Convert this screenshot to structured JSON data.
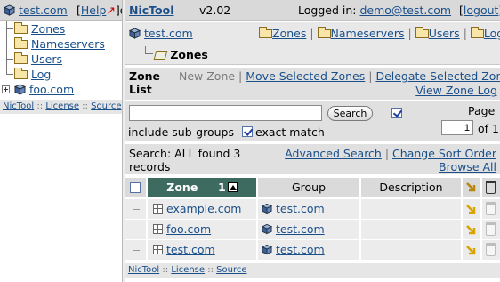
{
  "left": {
    "group": "test.com",
    "help": "Help",
    "help_tail": "]o",
    "tree": [
      "Zones",
      "Nameservers",
      "Users",
      "Log"
    ],
    "subgroup": "foo.com",
    "footer": [
      "NicTool",
      "License",
      "Source"
    ]
  },
  "header": {
    "app": "NicTool",
    "version": "v2.02",
    "logged_in_label": "Logged in:",
    "user": "demo@test.com",
    "logout": "logout"
  },
  "nav": {
    "group": "test.com",
    "links": [
      "Zones",
      "Nameservers",
      "Users",
      "Log"
    ]
  },
  "breadcrumb": {
    "label": "Zones"
  },
  "actions": {
    "title_1": "Zone",
    "title_2": "List",
    "new_zone": "New Zone",
    "move": "Move Selected Zones",
    "delegate": "Delegate Selected Zones",
    "view_log": "View Zone Log"
  },
  "search": {
    "query": "",
    "button": "Search",
    "sub_groups": "include sub-groups",
    "exact": "exact match",
    "page_label": "Page",
    "page": "1",
    "of": "of 1"
  },
  "result": {
    "found": "Search: ALL found 3 records",
    "advanced": "Advanced Search",
    "sort": "Change Sort Order",
    "browse": "Browse All"
  },
  "table": {
    "columns": {
      "zone": "Zone",
      "sort_index": "1",
      "group": "Group",
      "description": "Description"
    },
    "rows": [
      {
        "zone": "example.com",
        "group": "test.com",
        "description": ""
      },
      {
        "zone": "foo.com",
        "group": "test.com",
        "description": ""
      },
      {
        "zone": "test.com",
        "group": "test.com",
        "description": ""
      }
    ]
  },
  "main_footer": [
    "NicTool",
    "License",
    "Source"
  ],
  "colors": {
    "link": "#1a4f8a",
    "header_active": "#3d6b60",
    "panel": "#e0e0e0"
  },
  "icons": [
    "group-cube-icon",
    "folder-icon",
    "zone-icon",
    "move-arrow-icon",
    "trash-icon",
    "checkbox-icon",
    "sort-up-icon"
  ]
}
